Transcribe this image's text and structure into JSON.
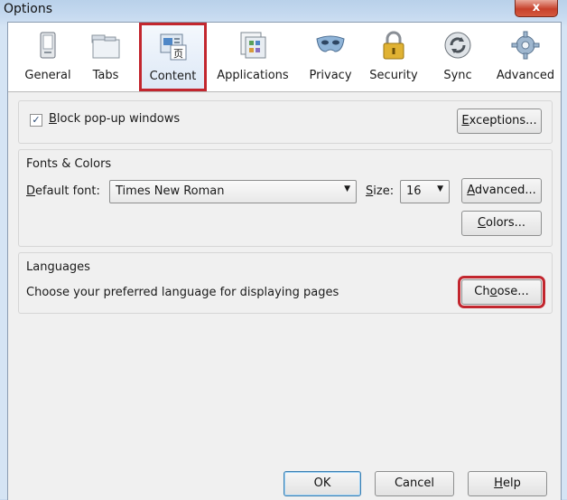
{
  "window": {
    "title": "Options",
    "close_glyph": "x"
  },
  "tabs": [
    {
      "label": "General",
      "icon": "general-icon"
    },
    {
      "label": "Tabs",
      "icon": "tabs-icon"
    },
    {
      "label": "Content",
      "icon": "content-icon",
      "selected": true
    },
    {
      "label": "Applications",
      "icon": "applications-icon"
    },
    {
      "label": "Privacy",
      "icon": "privacy-icon"
    },
    {
      "label": "Security",
      "icon": "security-icon"
    },
    {
      "label": "Sync",
      "icon": "sync-icon"
    },
    {
      "label": "Advanced",
      "icon": "advanced-icon"
    }
  ],
  "popups": {
    "checkbox_checked": true,
    "checkbox_label_first": "B",
    "checkbox_label_rest": "lock pop-up windows",
    "exceptions_label_first": "E",
    "exceptions_label_rest": "xceptions..."
  },
  "fonts": {
    "title": "Fonts & Colors",
    "default_font_label_first": "D",
    "default_font_label_rest": "efault font:",
    "default_font_value": "Times New Roman",
    "size_label_first": "S",
    "size_label_rest": "ize:",
    "size_value": "16",
    "advanced_label_first": "A",
    "advanced_label_rest": "dvanced...",
    "colors_label_first": "C",
    "colors_label_rest": "olors..."
  },
  "languages": {
    "title": "Languages",
    "description": "Choose your preferred language for displaying pages",
    "choose_label_pre": "Ch",
    "choose_label_u": "o",
    "choose_label_post": "ose..."
  },
  "footer": {
    "ok_label": "OK",
    "cancel_label": "Cancel",
    "help_label_first": "H",
    "help_label_rest": "elp"
  },
  "colors": {
    "highlight": "#c2262e",
    "title_bar": "#c6daf0",
    "client_bg": "#f0f0f0"
  }
}
